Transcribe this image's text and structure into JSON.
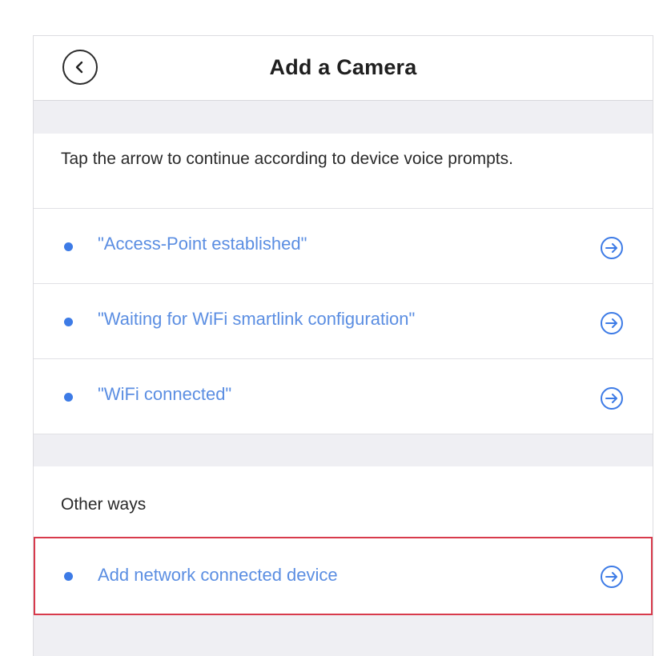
{
  "header": {
    "title": "Add a Camera"
  },
  "instructions": {
    "text": "Tap the arrow to continue according to device voice prompts."
  },
  "prompts": [
    {
      "label": "\"Access-Point established\""
    },
    {
      "label": "\"Waiting for WiFi smartlink configuration\""
    },
    {
      "label": "\"WiFi connected\""
    }
  ],
  "other_ways": {
    "heading": "Other ways",
    "items": [
      {
        "label": "Add network connected device",
        "highlighted": true
      }
    ]
  },
  "colors": {
    "accent": "#3d7be6",
    "link_text": "#5b8ee2",
    "highlight_border": "#d83a4c",
    "background": "#efeff3"
  },
  "icons": {
    "back": "chevron-left-icon",
    "row_arrow": "arrow-right-circle-icon"
  }
}
